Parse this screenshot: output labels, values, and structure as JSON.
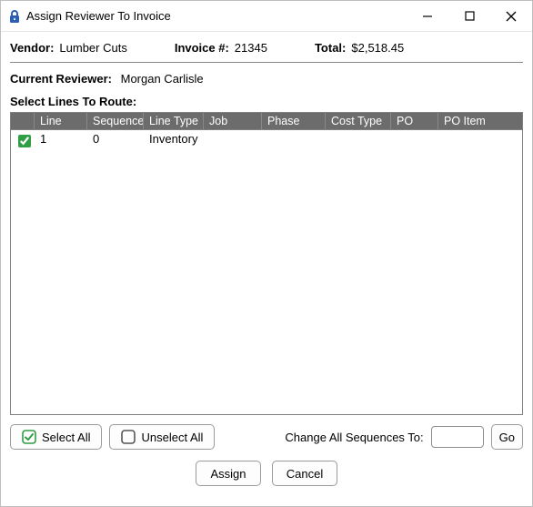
{
  "window": {
    "title": "Assign Reviewer To Invoice"
  },
  "header": {
    "vendor_label": "Vendor:",
    "vendor_value": "Lumber Cuts",
    "invoice_label": "Invoice #:",
    "invoice_value": "21345",
    "total_label": "Total:",
    "total_value": "$2,518.45"
  },
  "reviewer": {
    "label": "Current Reviewer:",
    "value": "Morgan Carlisle"
  },
  "grid": {
    "select_label": "Select Lines To Route:",
    "columns": {
      "check": "",
      "line": "Line",
      "sequence": "Sequence",
      "line_type": "Line Type",
      "job": "Job",
      "phase": "Phase",
      "cost_type": "Cost Type",
      "po": "PO",
      "po_item": "PO Item"
    },
    "rows": [
      {
        "checked": true,
        "line": "1",
        "sequence": "0",
        "line_type": "Inventory",
        "job": "",
        "phase": "",
        "cost_type": "",
        "po": "",
        "po_item": ""
      }
    ]
  },
  "toolbar": {
    "select_all": "Select All",
    "unselect_all": "Unselect All",
    "change_seq_label": "Change All Sequences To:",
    "seq_value": "",
    "go": "Go"
  },
  "footer": {
    "assign": "Assign",
    "cancel": "Cancel"
  }
}
